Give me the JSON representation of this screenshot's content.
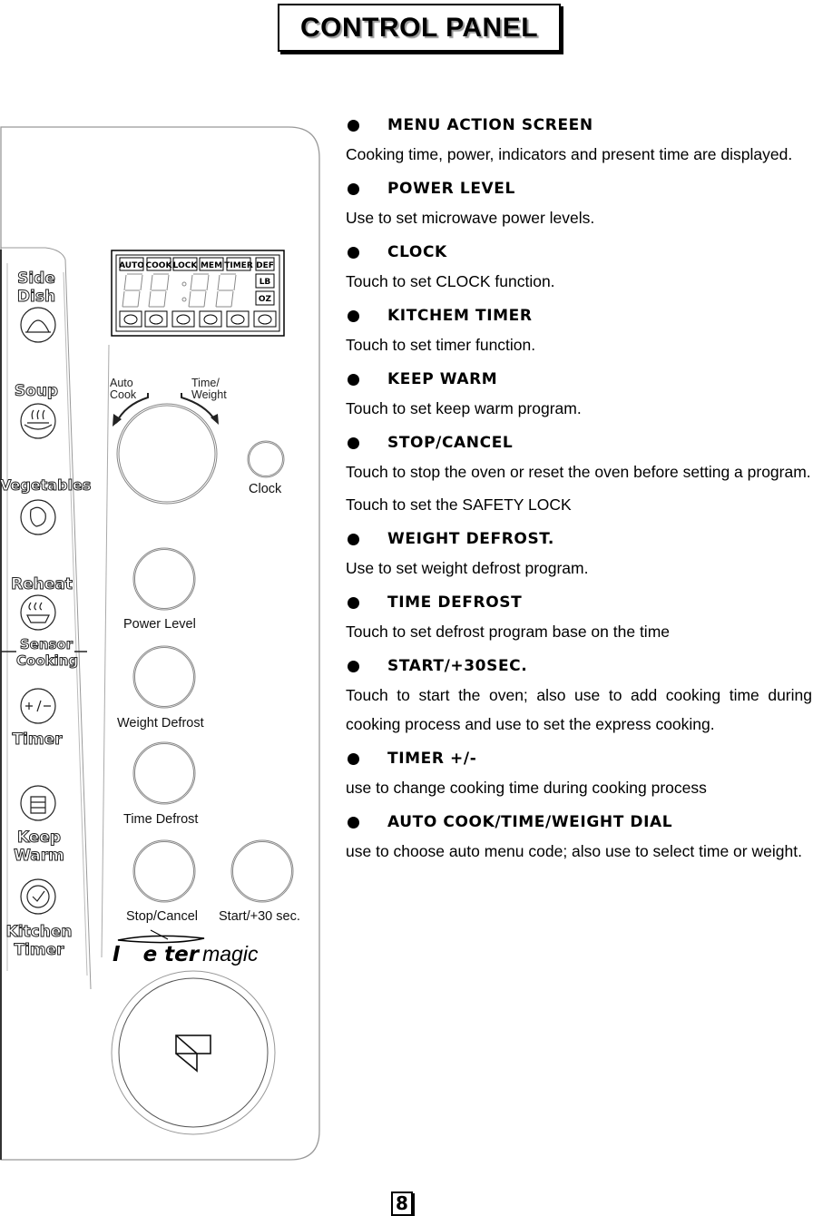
{
  "title": "CONTROL PANEL",
  "page_number": "8",
  "panel": {
    "lcd": {
      "indicators_top": [
        "AUTO",
        "COOK",
        "LOCK",
        "MEM",
        "TIMER",
        "DEF"
      ],
      "indicators_side": [
        "LB",
        "OZ"
      ],
      "food_icons": [
        "bread-icon",
        "soup-bowl-icon",
        "vegetables-icon",
        "cake-slice-icon",
        "cup-icon",
        "pizza-icon"
      ]
    },
    "side_buttons": [
      {
        "label": "Side Dish",
        "icon": "covered-dish-icon"
      },
      {
        "label": "Soup",
        "icon": "soup-icon"
      },
      {
        "label": "Vegetables",
        "icon": "vegetables-icon"
      },
      {
        "label": "Reheat",
        "icon": "reheat-icon"
      },
      {
        "label": "Timer",
        "icon": "plus-minus-icon",
        "symbol": "+/−"
      },
      {
        "label": "Keep Warm",
        "icon": "keep-warm-icon"
      },
      {
        "label": "Kitchen Timer",
        "icon": "kitchen-timer-icon"
      }
    ],
    "sensor_cooking_label": "Sensor Cooking",
    "dial_left_label": "Auto Cook",
    "dial_right_label": "Time/ Weight",
    "buttons": {
      "clock": "Clock",
      "power_level": "Power Level",
      "weight_defrost": "Weight Defrost",
      "time_defrost": "Time Defrost",
      "stop_cancel": "Stop/Cancel",
      "start_30": "Start/+30 sec."
    },
    "brand": {
      "part1": "I",
      "part2": "e ter",
      "part3": "magic"
    }
  },
  "descriptions": [
    {
      "heading": "MENU ACTION SCREEN",
      "body": [
        "Cooking time, power, indicators and present time are displayed."
      ]
    },
    {
      "heading": "POWER LEVEL",
      "body": [
        "Use to set microwave power levels."
      ]
    },
    {
      "heading": "CLOCK",
      "body": [
        "Touch to set CLOCK function."
      ]
    },
    {
      "heading": "KITCHEM TIMER",
      "body": [
        "Touch to set timer function."
      ]
    },
    {
      "heading": "KEEP WARM",
      "body": [
        "Touch to set keep warm program."
      ]
    },
    {
      "heading": "STOP/CANCEL",
      "body": [
        "Touch to stop the oven or reset the oven before setting a program.",
        "Touch to set the SAFETY LOCK"
      ]
    },
    {
      "heading": "WEIGHT DEFROST.",
      "body": [
        "Use to set weight defrost program."
      ]
    },
    {
      "heading": "TIME DEFROST",
      "body": [
        "Touch to set defrost program base on the time"
      ]
    },
    {
      "heading": "START/+30SEC.",
      "body": [
        "Touch to start the oven; also use to add cooking time during cooking process and use to set the express cooking."
      ]
    },
    {
      "heading": "TIMER +/-",
      "body": [
        "use to change cooking time during cooking process"
      ]
    },
    {
      "heading": "AUTO COOK/TIME/WEIGHT DIAL",
      "body": [
        "use to choose auto menu code; also use to select time or weight."
      ]
    }
  ]
}
